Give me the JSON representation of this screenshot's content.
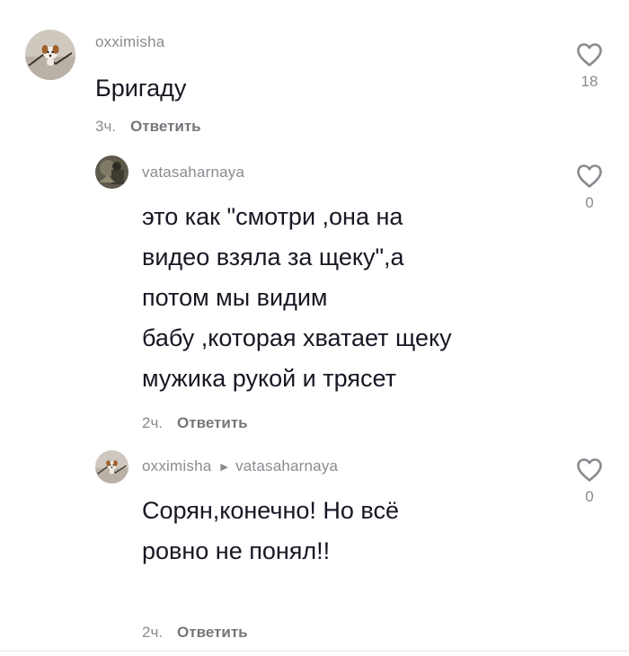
{
  "comments": [
    {
      "username": "oxximisha",
      "text": "Бригаду",
      "time": "3ч.",
      "reply_label": "Ответить",
      "likes": "18"
    },
    {
      "username": "vatasaharnaya",
      "text_lines": [
        "это как \"смотри ,она на",
        "видео взяла за щеку\",а",
        "потом мы видим",
        "бабу ,которая хватает щеку",
        "мужика рукой и трясет"
      ],
      "time": "2ч.",
      "reply_label": "Ответить",
      "likes": "0"
    },
    {
      "username": "oxximisha",
      "reply_to": "vatasaharnaya",
      "text_lines": [
        "Сорян,конечно! Но всё",
        "ровно не понял!!"
      ],
      "time": "2ч.",
      "reply_label": "Ответить",
      "likes": "0"
    }
  ],
  "icons": {
    "like": "heart-outline-icon",
    "reply_to": "triangle-right-icon",
    "more": "more-dots-icon"
  },
  "colors": {
    "text": "#161823",
    "secondary": "#8a8b91",
    "reply": "#75767c"
  }
}
